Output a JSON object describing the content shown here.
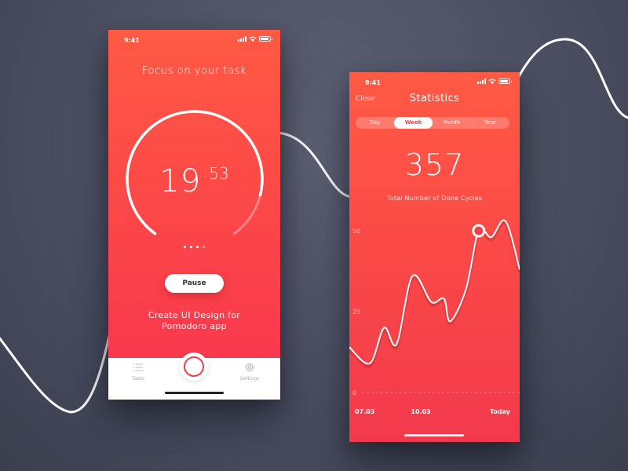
{
  "timer_screen": {
    "status_time": "9:41",
    "title": "Focus on your task",
    "timer_minutes": "19",
    "timer_separator": ":",
    "timer_seconds": "53",
    "timer_progress": 0.86,
    "page_count": 4,
    "active_page": 3,
    "pause_label": "Pause",
    "task_line_1": "Create UI Design for",
    "task_line_2": "Pomodoro app",
    "tab_bar": {
      "tasks_label": "Tasks",
      "tasks_icon": "list-icon",
      "record_icon": "record-circle-icon",
      "settings_label": "Settings",
      "settings_icon": "gear-icon"
    }
  },
  "stats_screen": {
    "status_time": "9:41",
    "close_label": "Close",
    "title": "Statistics",
    "segments": [
      {
        "label": "Day",
        "active": false
      },
      {
        "label": "Week",
        "active": true
      },
      {
        "label": "Month",
        "active": false
      },
      {
        "label": "Year",
        "active": false
      }
    ],
    "total_count": "357",
    "total_label": "Total Number of Done Cycles"
  },
  "colors": {
    "background": "#4b4f61",
    "accent_red": "#fd4a47",
    "ring_dim": "#ff8a84",
    "tab_gray": "#a7aab2"
  },
  "chart_data": {
    "type": "line",
    "x": [
      0,
      0.65,
      1.1,
      1.5,
      2,
      2.6,
      3,
      3.2,
      3.7,
      4.1,
      4.5,
      4.95,
      5.4
    ],
    "values": [
      14,
      9,
      20,
      15,
      36,
      28,
      29,
      22,
      32,
      50,
      48,
      53,
      38
    ],
    "y_ticks": [
      "50",
      "25",
      "0"
    ],
    "ylim": [
      0,
      50
    ],
    "x_tick_labels": [
      "07.03",
      "10.03",
      "Today"
    ],
    "x_tick_positions": [
      0.3,
      2.3,
      4.3
    ],
    "highlight_index": 9,
    "grid": false,
    "baseline_dashed": true
  }
}
